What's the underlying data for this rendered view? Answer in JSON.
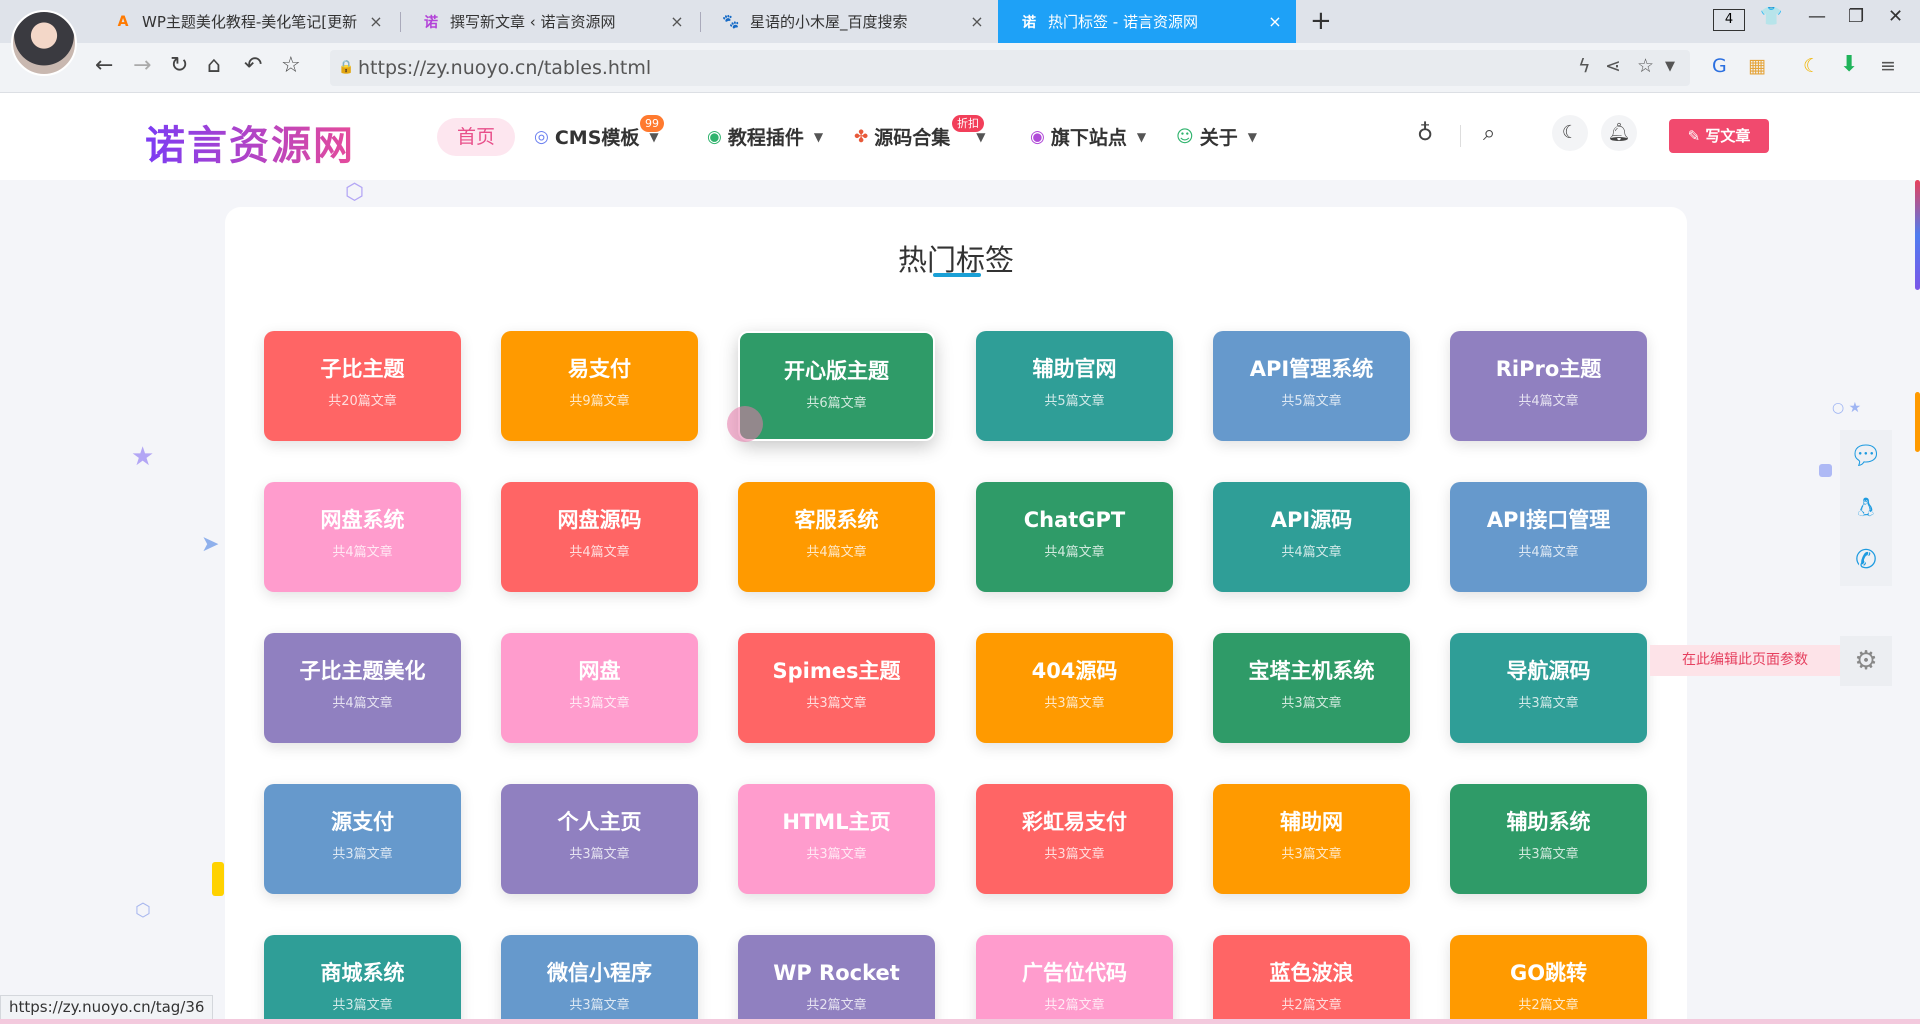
{
  "browser": {
    "tabs": [
      {
        "title": "WP主题美化教程-美化笔记[更新",
        "favicon": "A",
        "color": "#ff7a00"
      },
      {
        "title": "撰写新文章 ‹ 诺言资源网",
        "favicon": "诺",
        "color": "#b343d8"
      },
      {
        "title": "星语的小木屋_百度搜索",
        "favicon": "🐾",
        "color": "#2b55d6"
      },
      {
        "title": "热门标签 - 诺言资源网",
        "favicon": "诺",
        "color": "#b343d8"
      }
    ],
    "tab_count": "4",
    "url": "https://zy.nuoyo.cn/tables.html",
    "status_url": "https://zy.nuoyo.cn/tag/36"
  },
  "site": {
    "logo": "诺言资源网",
    "menu": {
      "home": "首页",
      "items": [
        {
          "label": "CMS模板",
          "icon": "◎",
          "badge": "99"
        },
        {
          "label": "教程插件",
          "icon": "◉",
          "badge": ""
        },
        {
          "label": "源码合集",
          "icon": "✤",
          "badge": "折扣"
        },
        {
          "label": "旗下站点",
          "icon": "◉",
          "badge": ""
        },
        {
          "label": "关于",
          "icon": "☺",
          "badge": ""
        }
      ]
    },
    "write_button": "写文章"
  },
  "page": {
    "title": "热门标签",
    "edit_hint": "在此编辑此页面参数",
    "tags": [
      {
        "name": "子比主题",
        "count": "共20篇文章",
        "color": "red"
      },
      {
        "name": "易支付",
        "count": "共9篇文章",
        "color": "orange"
      },
      {
        "name": "开心版主题",
        "count": "共6篇文章",
        "color": "green"
      },
      {
        "name": "辅助官网",
        "count": "共5篇文章",
        "color": "teal"
      },
      {
        "name": "API管理系统",
        "count": "共5篇文章",
        "color": "blue"
      },
      {
        "name": "RiPro主题",
        "count": "共4篇文章",
        "color": "purple"
      },
      {
        "name": "网盘系统",
        "count": "共4篇文章",
        "color": "pink"
      },
      {
        "name": "网盘源码",
        "count": "共4篇文章",
        "color": "red"
      },
      {
        "name": "客服系统",
        "count": "共4篇文章",
        "color": "orange"
      },
      {
        "name": "ChatGPT",
        "count": "共4篇文章",
        "color": "green"
      },
      {
        "name": "API源码",
        "count": "共4篇文章",
        "color": "teal"
      },
      {
        "name": "API接口管理",
        "count": "共4篇文章",
        "color": "blue"
      },
      {
        "name": "子比主题美化",
        "count": "共4篇文章",
        "color": "purple"
      },
      {
        "name": "网盘",
        "count": "共3篇文章",
        "color": "pink"
      },
      {
        "name": "Spimes主题",
        "count": "共3篇文章",
        "color": "red"
      },
      {
        "name": "404源码",
        "count": "共3篇文章",
        "color": "orange"
      },
      {
        "name": "宝塔主机系统",
        "count": "共3篇文章",
        "color": "green"
      },
      {
        "name": "导航源码",
        "count": "共3篇文章",
        "color": "teal"
      },
      {
        "name": "源支付",
        "count": "共3篇文章",
        "color": "blue"
      },
      {
        "name": "个人主页",
        "count": "共3篇文章",
        "color": "purple"
      },
      {
        "name": "HTML主页",
        "count": "共3篇文章",
        "color": "pink"
      },
      {
        "name": "彩虹易支付",
        "count": "共3篇文章",
        "color": "red"
      },
      {
        "name": "辅助网",
        "count": "共3篇文章",
        "color": "orange"
      },
      {
        "name": "辅助系统",
        "count": "共3篇文章",
        "color": "green"
      },
      {
        "name": "商城系统",
        "count": "共3篇文章",
        "color": "teal"
      },
      {
        "name": "微信小程序",
        "count": "共3篇文章",
        "color": "blue"
      },
      {
        "name": "WP Rocket",
        "count": "共2篇文章",
        "color": "purple"
      },
      {
        "name": "广告位代码",
        "count": "共2篇文章",
        "color": "pink"
      },
      {
        "name": "蓝色波浪",
        "count": "共2篇文章",
        "color": "red"
      },
      {
        "name": "GO跳转",
        "count": "共2篇文章",
        "color": "orange"
      }
    ]
  }
}
